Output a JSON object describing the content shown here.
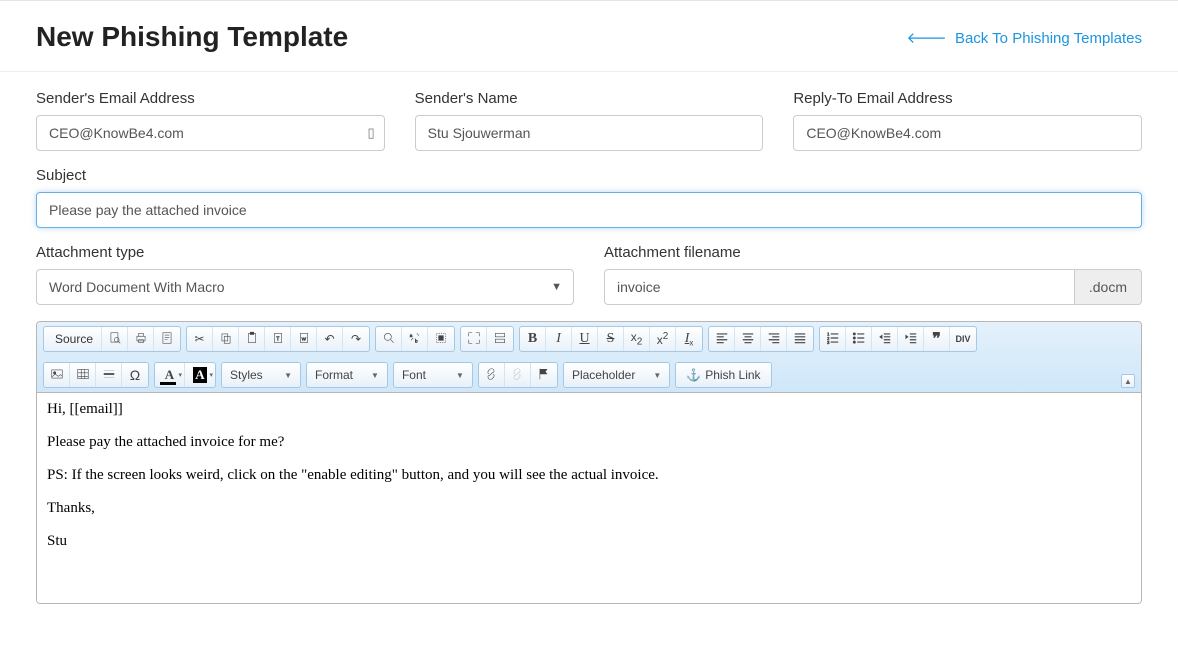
{
  "header": {
    "title": "New Phishing Template",
    "back_link": "Back To Phishing Templates"
  },
  "fields": {
    "sender_email": {
      "label": "Sender's Email Address",
      "value": "CEO@KnowBe4.com"
    },
    "sender_name": {
      "label": "Sender's Name",
      "value": "Stu Sjouwerman"
    },
    "reply_to": {
      "label": "Reply-To Email Address",
      "value": "CEO@KnowBe4.com"
    },
    "subject": {
      "label": "Subject",
      "value": "Please pay the attached invoice"
    },
    "attach_type": {
      "label": "Attachment type",
      "value": "Word Document With Macro"
    },
    "attach_name": {
      "label": "Attachment filename",
      "value": "invoice",
      "ext": ".docm"
    }
  },
  "toolbar": {
    "source": "Source",
    "styles": "Styles",
    "format": "Format",
    "font": "Font",
    "placeholder": "Placeholder",
    "phish_link": "Phish Link"
  },
  "editor_body": {
    "p1": "Hi, [[email]]",
    "p2": "Please pay the attached invoice for me?",
    "p3": "PS: If the screen looks weird, click on the \"enable editing\" button, and you will see the actual invoice.",
    "p4": "Thanks,",
    "p5": "Stu"
  }
}
